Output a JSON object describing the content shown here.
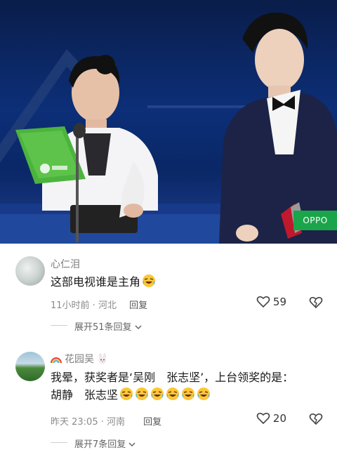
{
  "video": {
    "watermark": "OPPO"
  },
  "comments": [
    {
      "author": "心仁泪",
      "text": "这部电视谁是主角",
      "emoji_count": 1,
      "time_location": "11小时前 · 河北",
      "reply_label": "回复",
      "likes": "59",
      "expand_label": "展开51条回复"
    },
    {
      "author": "花园吴",
      "text_line1": "我晕，获奖者是‘吴刚　张志坚’，上台领奖的是：",
      "text_line2": "胡静　张志坚",
      "emoji_count": 6,
      "time_location": "昨天 23:05 · 河南",
      "reply_label": "回复",
      "likes": "20",
      "expand_label": "展开7条回复"
    }
  ],
  "icons": {
    "like": "heart-outline-icon",
    "dislike": "broken-heart-icon",
    "expand": "chevron-down-icon",
    "emoji": "rolling-laughing-emoji",
    "author_prefix": "rainbow-icon",
    "author_suffix": "rabbit-face-icon"
  },
  "colors": {
    "text": "#1a1a1a",
    "meta": "#8a8a8a",
    "oppo_badge": "#1aa54a"
  }
}
